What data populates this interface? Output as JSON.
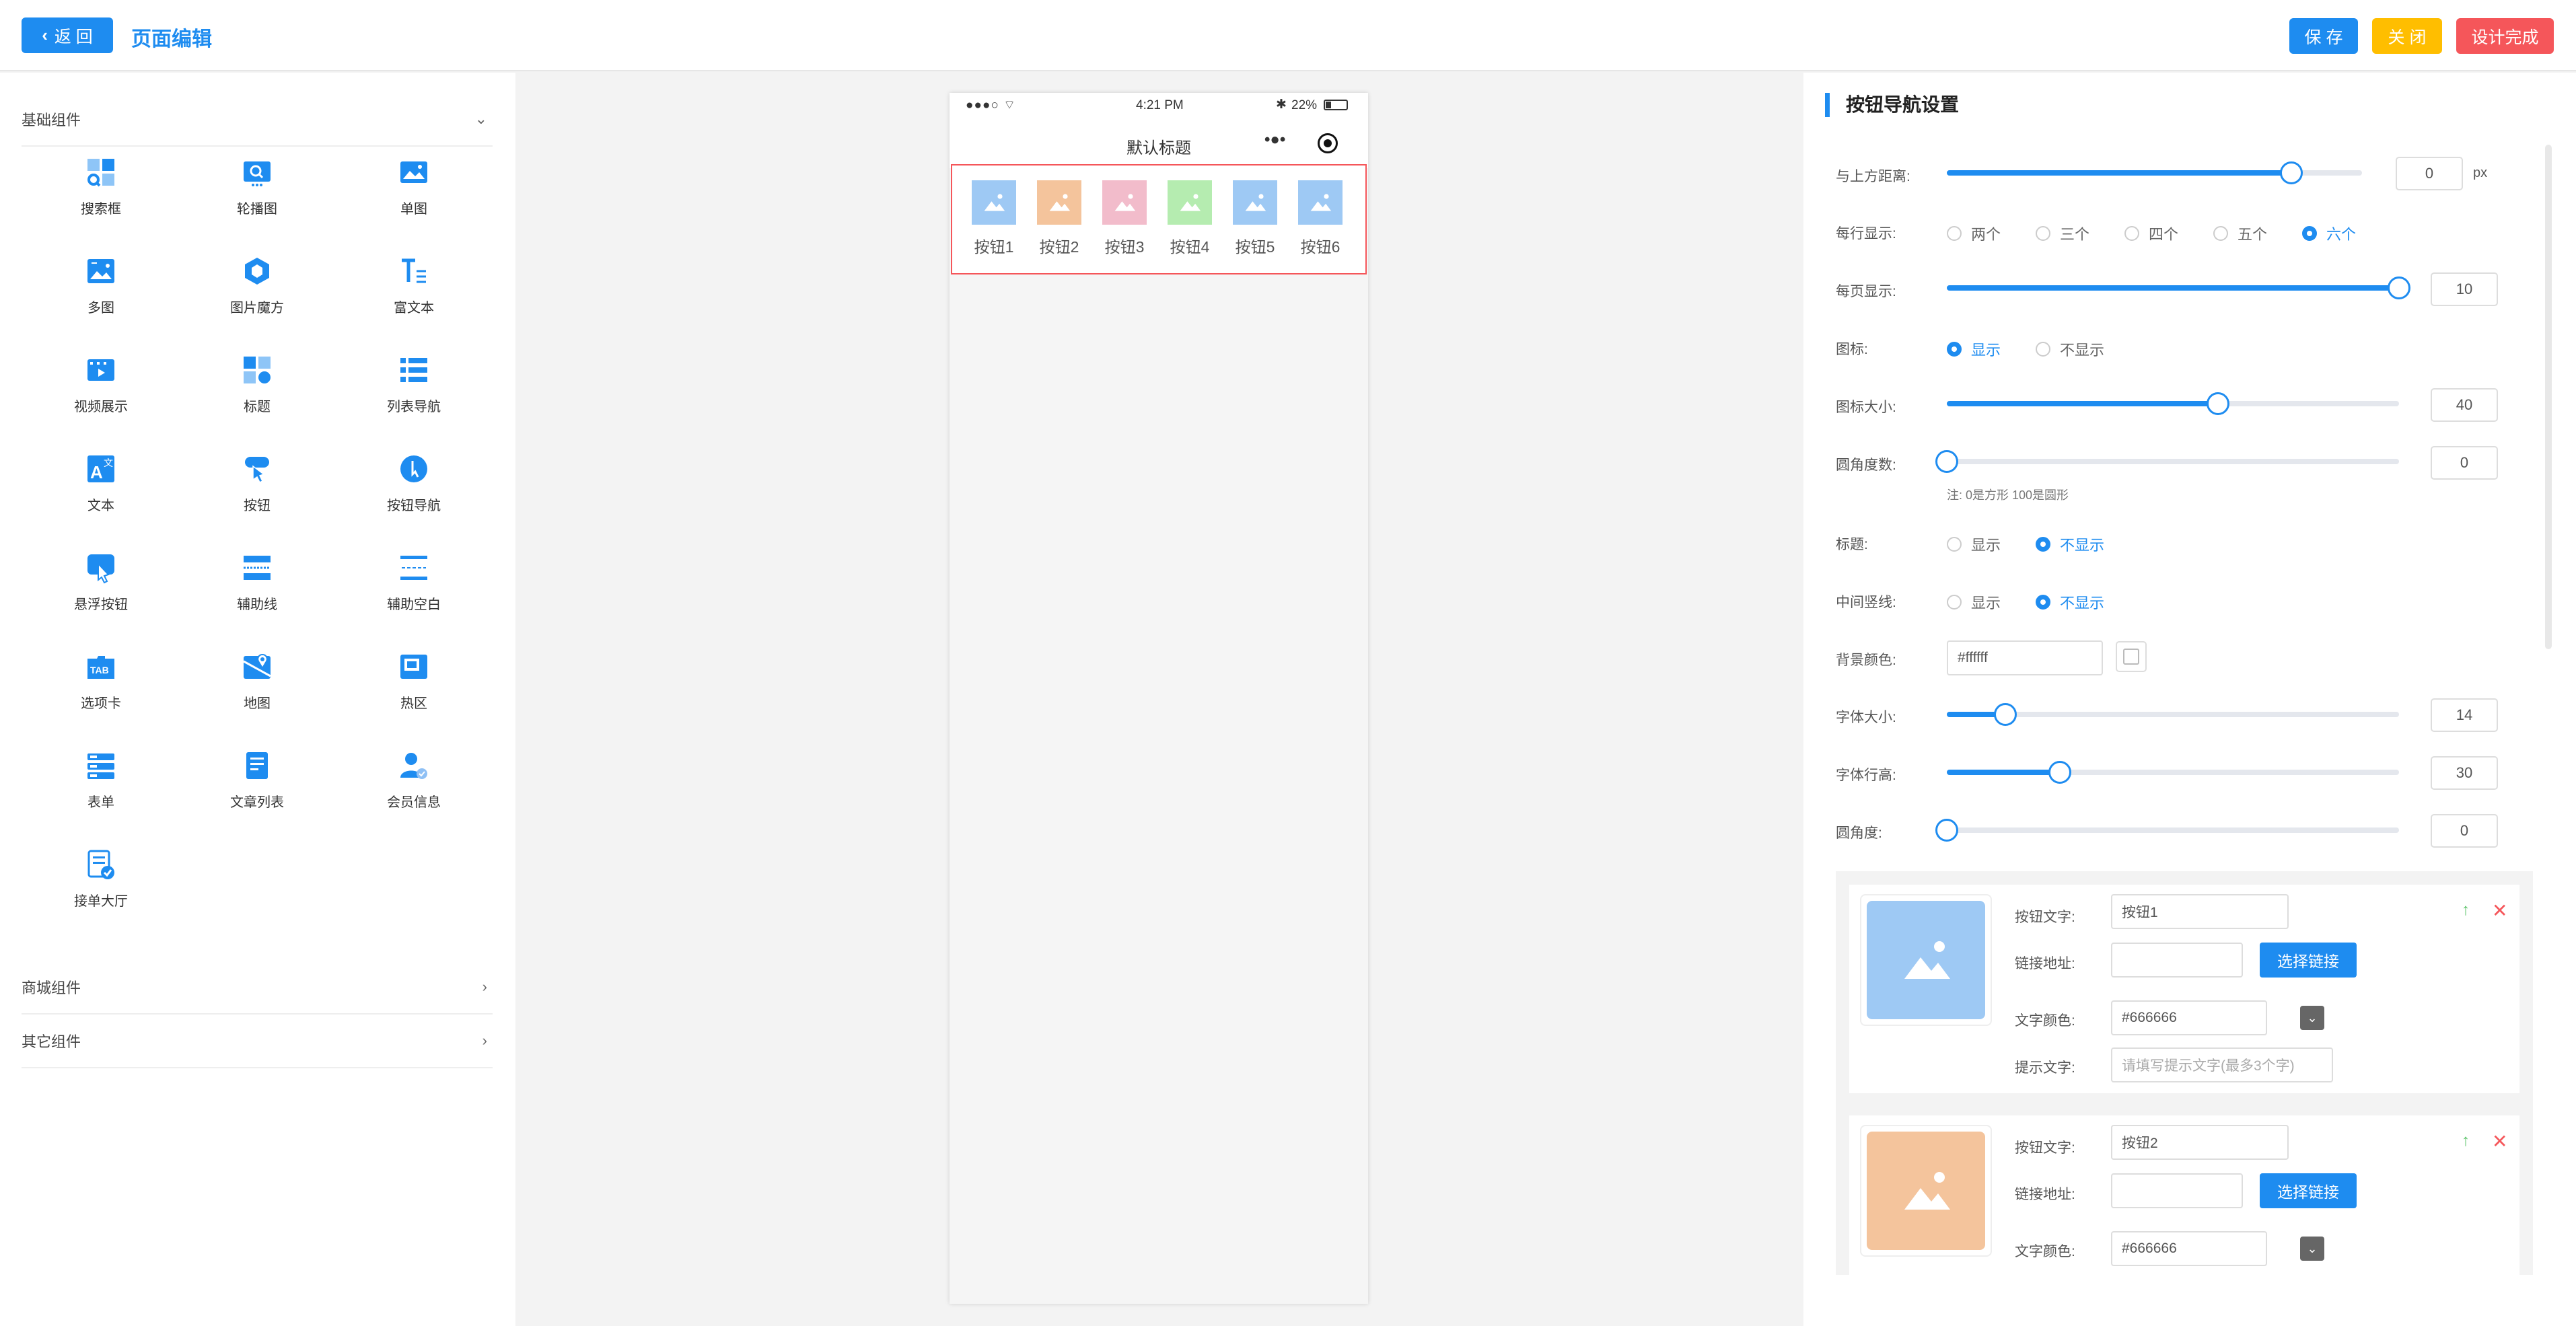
{
  "header": {
    "back_label": "返 回",
    "page_title": "页面编辑",
    "save_label": "保 存",
    "close_label": "关 闭",
    "done_label": "设计完成"
  },
  "left_panel": {
    "sections": [
      {
        "label": "基础组件",
        "expanded": true
      },
      {
        "label": "商城组件",
        "expanded": false
      },
      {
        "label": "其它组件",
        "expanded": false
      }
    ],
    "components": [
      {
        "label": "搜索框",
        "icon": "search-box-icon"
      },
      {
        "label": "轮播图",
        "icon": "carousel-icon"
      },
      {
        "label": "单图",
        "icon": "single-image-icon"
      },
      {
        "label": "多图",
        "icon": "multi-image-icon"
      },
      {
        "label": "图片魔方",
        "icon": "image-cube-icon"
      },
      {
        "label": "富文本",
        "icon": "rich-text-icon"
      },
      {
        "label": "视频展示",
        "icon": "video-icon"
      },
      {
        "label": "标题",
        "icon": "title-icon"
      },
      {
        "label": "列表导航",
        "icon": "list-nav-icon"
      },
      {
        "label": "文本",
        "icon": "text-icon"
      },
      {
        "label": "按钮",
        "icon": "button-icon"
      },
      {
        "label": "按钮导航",
        "icon": "button-nav-icon"
      },
      {
        "label": "悬浮按钮",
        "icon": "float-button-icon"
      },
      {
        "label": "辅助线",
        "icon": "guide-line-icon"
      },
      {
        "label": "辅助空白",
        "icon": "blank-space-icon"
      },
      {
        "label": "选项卡",
        "icon": "tab-icon"
      },
      {
        "label": "地图",
        "icon": "map-icon"
      },
      {
        "label": "热区",
        "icon": "hotspot-icon"
      },
      {
        "label": "表单",
        "icon": "form-icon"
      },
      {
        "label": "文章列表",
        "icon": "article-list-icon"
      },
      {
        "label": "会员信息",
        "icon": "member-icon"
      },
      {
        "label": "接单大厅",
        "icon": "order-hall-icon"
      }
    ]
  },
  "phone": {
    "time": "4:21 PM",
    "battery": "22%",
    "nav_title": "默认标题",
    "buttons": [
      {
        "label": "按钮1",
        "color": "#9ec9f4"
      },
      {
        "label": "按钮2",
        "color": "#f4c49c"
      },
      {
        "label": "按钮3",
        "color": "#f2bccb"
      },
      {
        "label": "按钮4",
        "color": "#b5ecb0"
      },
      {
        "label": "按钮5",
        "color": "#9ec9f4"
      },
      {
        "label": "按钮6",
        "color": "#9ec9f4"
      }
    ]
  },
  "settings": {
    "title": "按钮导航设置",
    "top_distance": {
      "label": "与上方距离:",
      "value": "0",
      "unit": "px",
      "level": 0.83
    },
    "per_row": {
      "label": "每行显示:",
      "options": [
        "两个",
        "三个",
        "四个",
        "五个",
        "六个"
      ],
      "selected": "六个"
    },
    "per_page": {
      "label": "每页显示:",
      "value": "10",
      "level": 1.0
    },
    "icon": {
      "label": "图标:",
      "options": [
        "显示",
        "不显示"
      ],
      "selected": "显示"
    },
    "icon_size": {
      "label": "图标大小:",
      "value": "40",
      "level": 0.6
    },
    "corner": {
      "label": "圆角度数:",
      "value": "0",
      "level": 0,
      "note": "注: 0是方形 100是圆形"
    },
    "title_show": {
      "label": "标题:",
      "options": [
        "显示",
        "不显示"
      ],
      "selected": "不显示"
    },
    "divider": {
      "label": "中间竖线:",
      "options": [
        "显示",
        "不显示"
      ],
      "selected": "不显示"
    },
    "bg_color": {
      "label": "背景颜色:",
      "value": "#ffffff"
    },
    "font_size": {
      "label": "字体大小:",
      "value": "14",
      "level": 0.13
    },
    "line_height": {
      "label": "字体行高:",
      "value": "30",
      "level": 0.25
    },
    "radius": {
      "label": "圆角度:",
      "value": "0",
      "level": 0
    }
  },
  "cards": [
    {
      "text_label": "按钮文字:",
      "text_value": "按钮1",
      "link_label": "链接地址:",
      "link_value": "",
      "select_link": "选择链接",
      "color_label": "文字颜色:",
      "color_value": "#666666",
      "tip_label": "提示文字:",
      "tip_placeholder": "请填写提示文字(最多3个字)",
      "image_color": "#9ec9f4"
    },
    {
      "text_label": "按钮文字:",
      "text_value": "按钮2",
      "link_label": "链接地址:",
      "link_value": "",
      "select_link": "选择链接",
      "color_label": "文字颜色:",
      "color_value": "#666666",
      "image_color": "#f4c49c"
    }
  ]
}
